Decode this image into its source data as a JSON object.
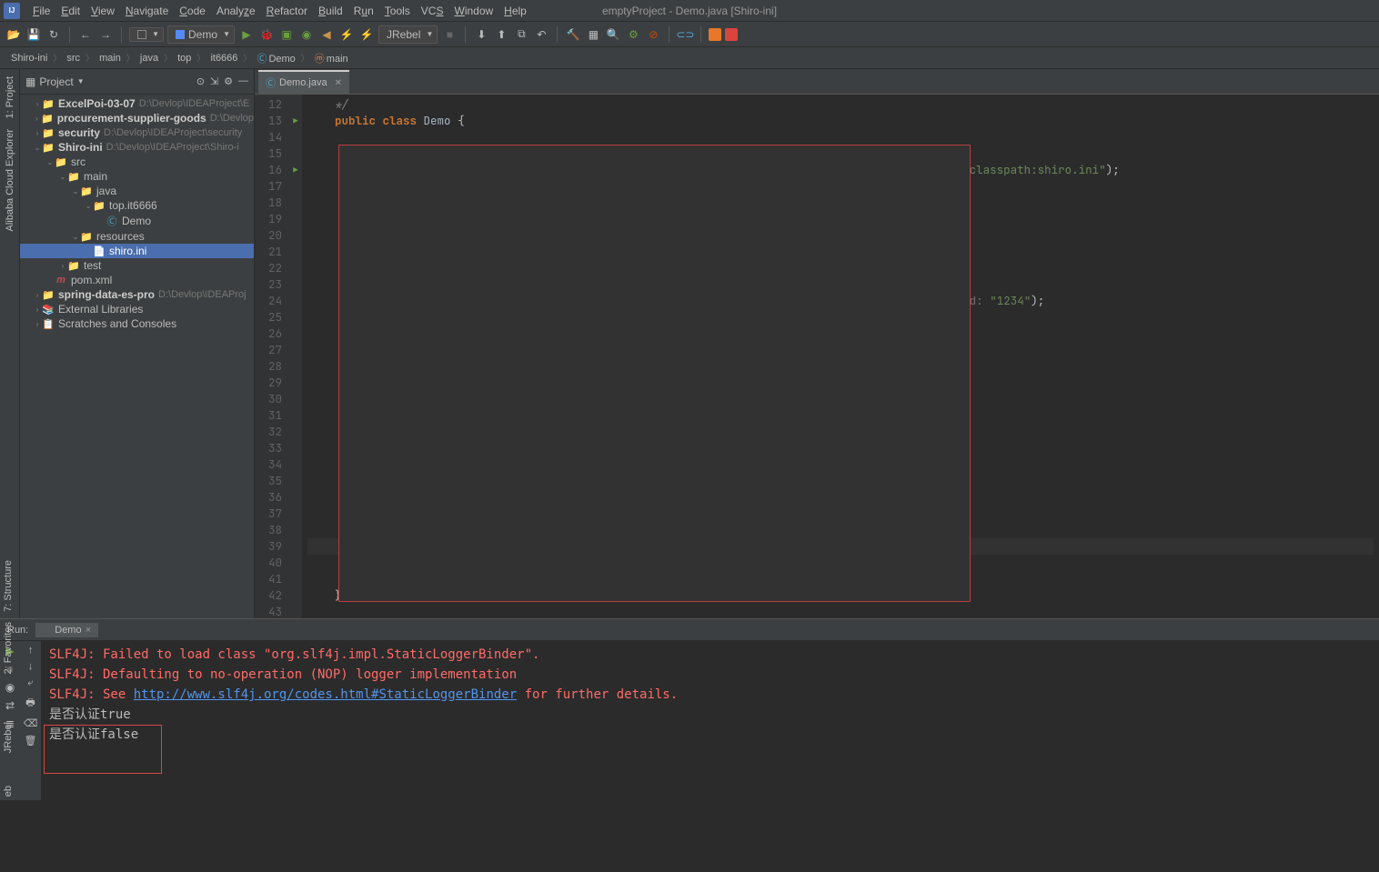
{
  "menubar": {
    "items": [
      "File",
      "Edit",
      "View",
      "Navigate",
      "Code",
      "Analyze",
      "Refactor",
      "Build",
      "Run",
      "Tools",
      "VCS",
      "Window",
      "Help"
    ],
    "title": "emptyProject - Demo.java [Shiro-ini]"
  },
  "toolbar": {
    "runconf": "Demo",
    "jrebel": "JRebel"
  },
  "nav": {
    "crumbs": [
      "Shiro-ini",
      "src",
      "main",
      "java",
      "top",
      "it6666",
      "Demo",
      "main"
    ]
  },
  "project": {
    "title": "Project",
    "tree": [
      {
        "d": 1,
        "a": ">",
        "i": "📁",
        "t": "ExcelPoi-03-07",
        "p": "D:\\Devlop\\IDEAProject\\E",
        "b": true
      },
      {
        "d": 1,
        "a": ">",
        "i": "📁",
        "t": "procurement-supplier-goods",
        "p": "D:\\Devlop",
        "b": true
      },
      {
        "d": 1,
        "a": ">",
        "i": "📁",
        "t": "security",
        "p": "D:\\Devlop\\IDEAProject\\security",
        "b": true
      },
      {
        "d": 1,
        "a": "v",
        "i": "📁",
        "t": "Shiro-ini",
        "p": "D:\\Devlop\\IDEAProject\\Shiro-i",
        "b": true
      },
      {
        "d": 2,
        "a": "v",
        "i": "📁",
        "t": "src",
        "b": false
      },
      {
        "d": 3,
        "a": "v",
        "i": "📁",
        "t": "main",
        "b": false
      },
      {
        "d": 4,
        "a": "v",
        "i": "📁",
        "t": "java",
        "b": false
      },
      {
        "d": 5,
        "a": "v",
        "i": "📁",
        "t": "top.it6666",
        "b": false
      },
      {
        "d": 6,
        "a": "",
        "i": "C",
        "t": "Demo",
        "b": false,
        "c": true
      },
      {
        "d": 4,
        "a": "v",
        "i": "📁",
        "t": "resources",
        "b": false
      },
      {
        "d": 5,
        "a": "",
        "i": "📄",
        "t": "shiro.ini",
        "b": false,
        "sel": true
      },
      {
        "d": 3,
        "a": ">",
        "i": "📁",
        "t": "test",
        "b": false
      },
      {
        "d": 2,
        "a": "",
        "i": "m",
        "t": "pom.xml",
        "b": false,
        "m": true
      },
      {
        "d": 1,
        "a": ">",
        "i": "📁",
        "t": "spring-data-es-pro",
        "p": "D:\\Devlop\\IDEAProj",
        "b": true
      },
      {
        "d": 1,
        "a": ">",
        "i": "📚",
        "t": "External Libraries",
        "b": false
      },
      {
        "d": 1,
        "a": ">",
        "i": "📋",
        "t": "Scratches and Consoles",
        "b": false
      }
    ]
  },
  "editor": {
    "tab": "Demo.java",
    "startLine": 12,
    "endLine": 43
  },
  "run": {
    "label": "Run:",
    "tab": "Demo",
    "lines": [
      {
        "t": "SLF4J: Failed to load class \"org.slf4j.impl.StaticLoggerBinder\".",
        "c": "red"
      },
      {
        "t": "SLF4J: Defaulting to no-operation (NOP) logger implementation",
        "c": "red"
      },
      {
        "pre": "SLF4J: See ",
        "link": "http://www.slf4j.org/codes.html#StaticLoggerBinder",
        "post": " for further details.",
        "c": "red"
      },
      {
        "t": "是否认证true",
        "c": ""
      },
      {
        "t": "是否认证false",
        "c": ""
      }
    ]
  },
  "leftTabs": {
    "t1": "1: Project",
    "t2": "Alibaba Cloud Explorer",
    "t3": "7: Structure",
    "t4": "2: Favorites",
    "t5": "JRebel",
    "t6": "eb"
  }
}
